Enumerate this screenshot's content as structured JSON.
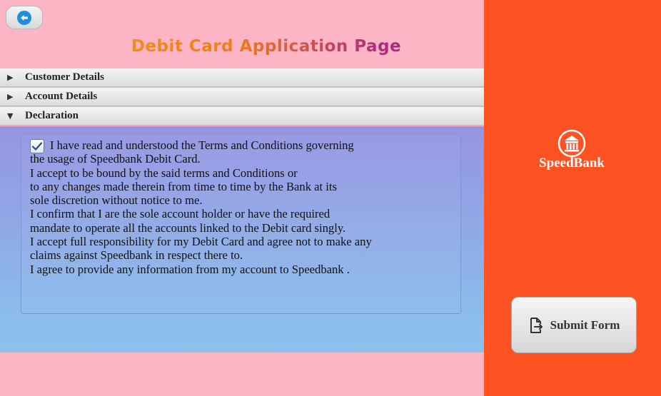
{
  "header": {
    "back_button_icon": "back-arrow-icon",
    "title": "Debit Card Application Page"
  },
  "accordion": [
    {
      "label": "Customer Details",
      "expanded": false,
      "arrow": "▶"
    },
    {
      "label": "Account Details",
      "expanded": false,
      "arrow": "▶"
    },
    {
      "label": "Declaration",
      "expanded": true,
      "arrow": "▼"
    }
  ],
  "declaration": {
    "checked": true,
    "lines": [
      "I have read and understood the Terms and Conditions governing",
      "the usage of Speedbank Debit Card.",
      "I accept to be bound by the said terms and Conditions or",
      "to any changes made therein from time to time by the Bank at its",
      "sole discretion without notice to me.",
      "I confirm that I are the sole account holder or have the required",
      "mandate to operate all the accounts linked to the Debit card singly.",
      "I accept full responsibility for my Debit Card and agree not to make any",
      "claims against Speedbank in respect there to.",
      "I agree to provide any information from my account to Speedbank ."
    ]
  },
  "sidebar": {
    "logo_icon": "bank-building-icon",
    "brand_name": "SpeedBank",
    "submit_label": "Submit Form",
    "submit_icon": "file-export-icon"
  },
  "colors": {
    "left_background": "#fdb5c6",
    "right_background": "#ff5223",
    "panel_gradient_top": "#9594e2",
    "panel_gradient_bottom": "#89c3ec",
    "back_icon": "#1e8fe0"
  }
}
